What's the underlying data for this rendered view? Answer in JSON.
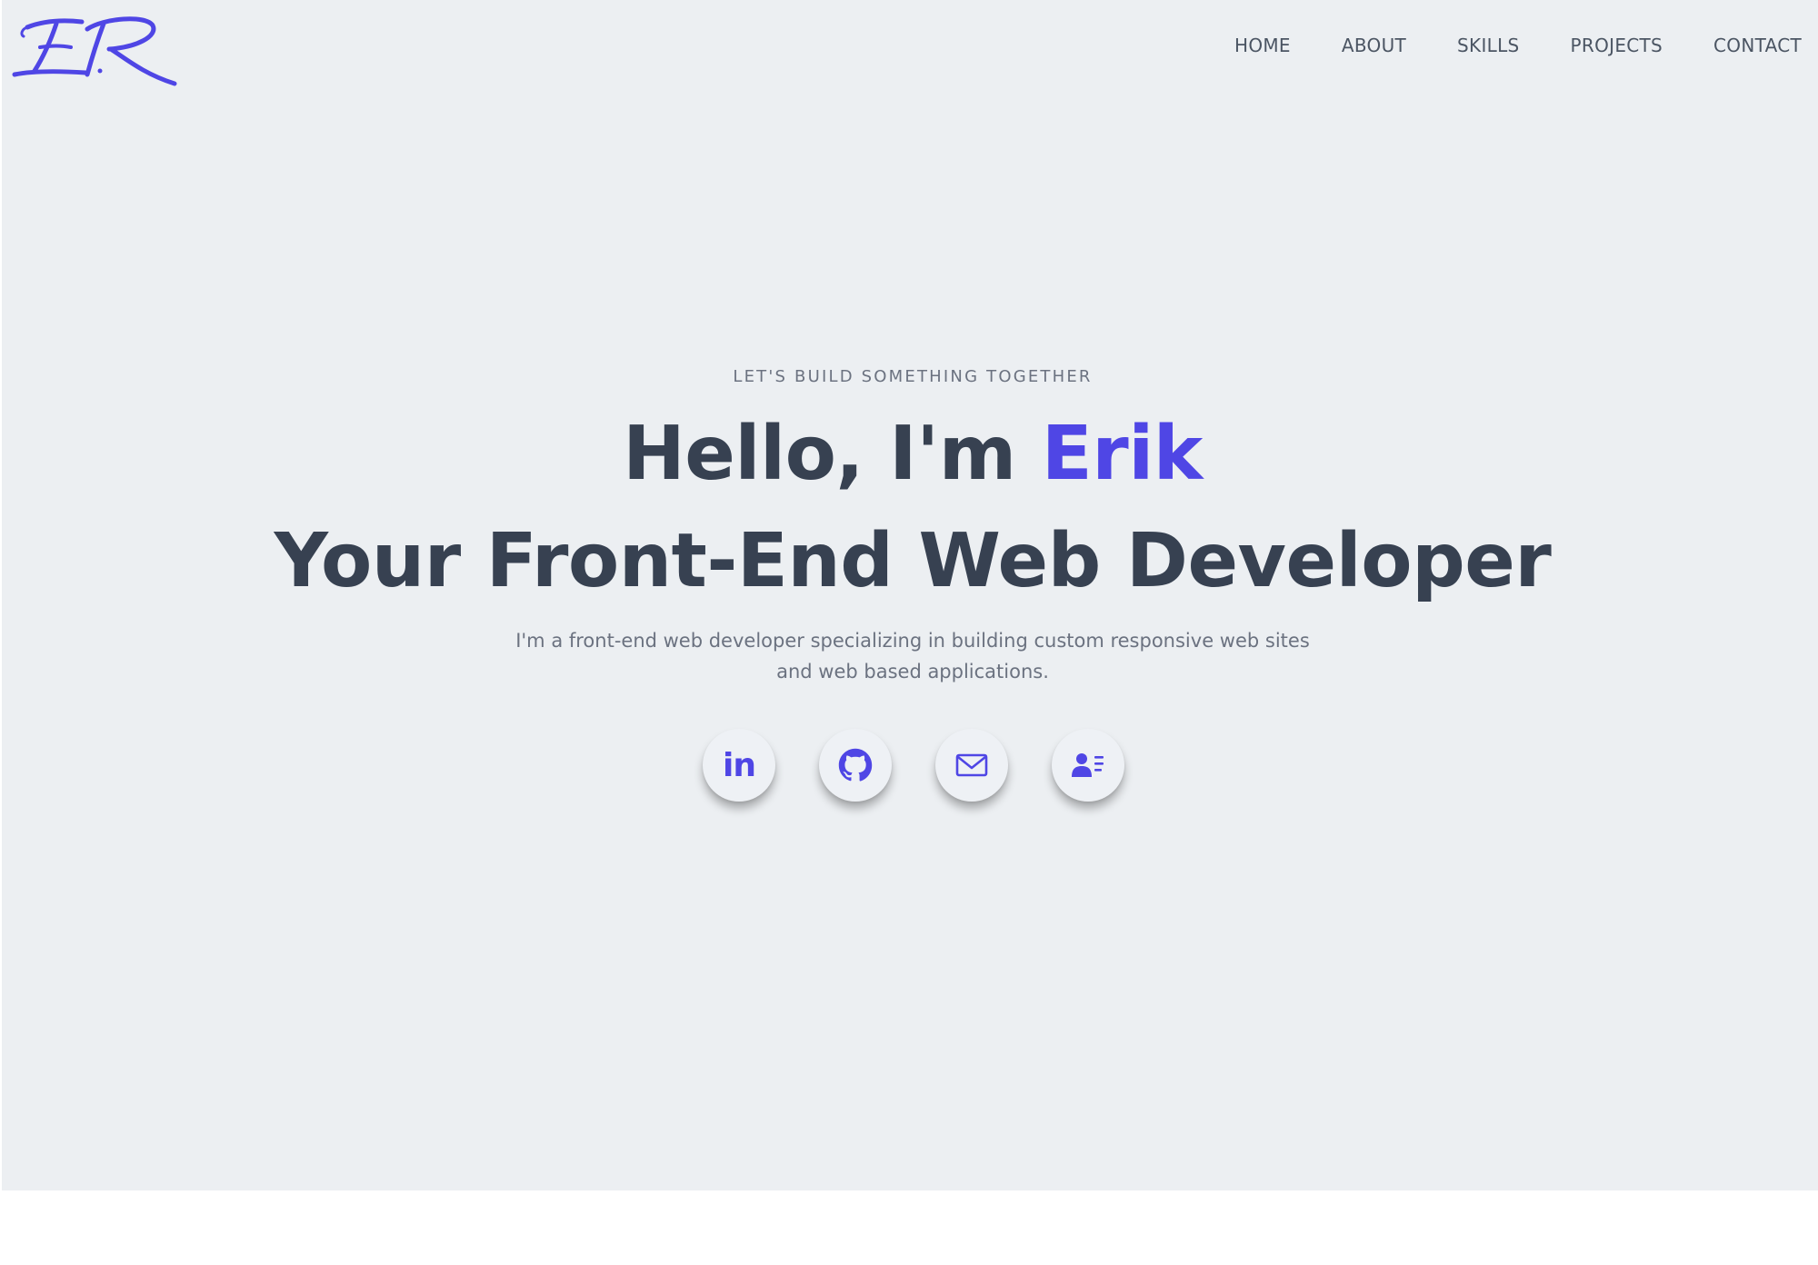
{
  "logo": {
    "text": "ER",
    "color": "#4f46e5"
  },
  "nav": {
    "items": [
      {
        "label": "HOME"
      },
      {
        "label": "ABOUT"
      },
      {
        "label": "SKILLS"
      },
      {
        "label": "PROJECTS"
      },
      {
        "label": "CONTACT"
      }
    ]
  },
  "hero": {
    "eyebrow": "LET'S BUILD SOMETHING TOGETHER",
    "greeting": "Hello, I'm ",
    "name": "Erik",
    "title": "Your Front-End Web Developer",
    "description_line1": "I'm a front-end web developer specializing in building custom responsive web sites",
    "description_line2": "and web based applications.",
    "accent_color": "#4f46e5",
    "text_color": "#374151",
    "background": "#eceff2"
  },
  "socials": [
    {
      "icon": "linkedin-icon",
      "text": "in"
    },
    {
      "icon": "github-icon"
    },
    {
      "icon": "mail-icon"
    },
    {
      "icon": "contact-card-icon"
    }
  ]
}
